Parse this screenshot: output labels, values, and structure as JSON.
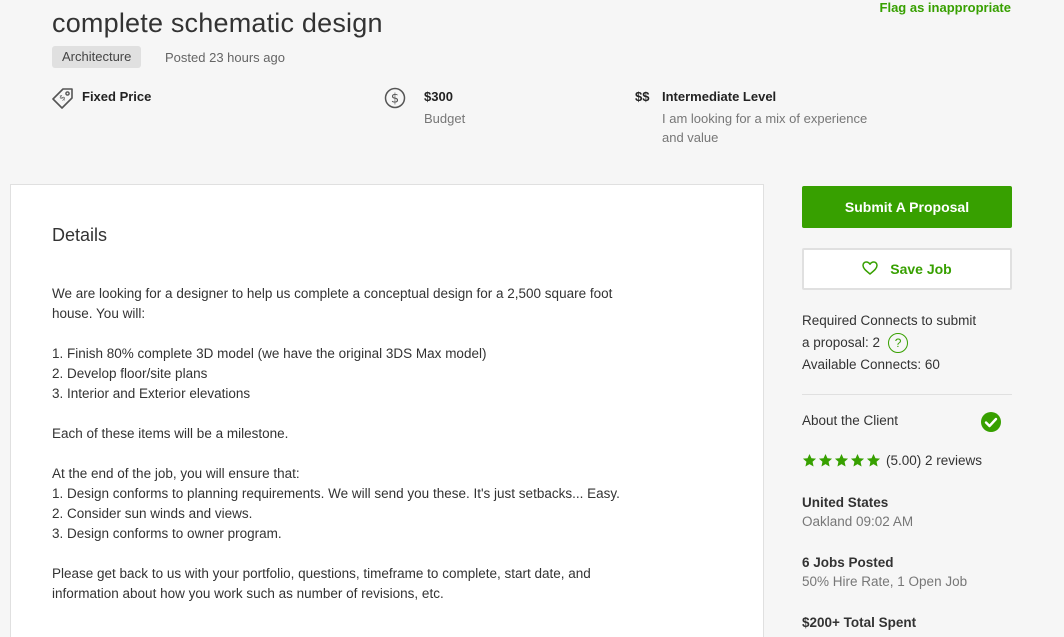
{
  "job": {
    "title": "complete schematic design",
    "flag_label": "Flag as inappropriate",
    "category": "Architecture",
    "posted": "Posted 23 hours ago"
  },
  "meta": {
    "type": {
      "icon": "price-tag-icon",
      "label": "Fixed Price"
    },
    "budget": {
      "icon": "dollar-circle-icon",
      "value": "$300",
      "label": "Budget"
    },
    "level": {
      "icon_text": "$$",
      "label": "Intermediate Level",
      "desc_line1": "I am looking for a mix of experience",
      "desc_line2": "and value"
    }
  },
  "details": {
    "heading": "Details",
    "line1": "We are looking for a designer to help us complete a conceptual design for a 2,500 square foot",
    "line2": "house. You will:",
    "list1": [
      "1. Finish 80% complete 3D model (we have the original 3DS Max model)",
      "2. Develop floor/site plans",
      "3. Interior and Exterior elevations"
    ],
    "milestone": "Each of these items will be a milestone.",
    "ensure_intro": "At the end of the job, you will ensure that:",
    "list2": [
      "1. Design conforms to planning requirements. We will send you these. It's just setbacks... Easy.",
      "2. Consider sun winds and views.",
      "3. Design conforms to owner program."
    ],
    "closing1": "Please get back to us with your portfolio, questions, timeframe to complete, start date, and",
    "closing2": "information about how you work such as number of revisions, etc."
  },
  "sidebar": {
    "submit_label": "Submit A Proposal",
    "save_label": "Save Job",
    "connects_line1": "Required Connects to submit",
    "connects_line2": "a proposal: 2",
    "help_glyph": "?",
    "available": "Available Connects: 60",
    "about_client": "About the Client",
    "rating_text": "(5.00) 2 reviews",
    "rating_value": 5,
    "country": "United States",
    "city_time": "Oakland 09:02 AM",
    "jobs_posted": "6 Jobs Posted",
    "hire_rate": "50% Hire Rate, 1 Open Job",
    "total_spent": "$200+ Total Spent"
  },
  "colors": {
    "accent": "#37a000",
    "star": "#37a000",
    "tag_bg": "#e0e0e0"
  }
}
